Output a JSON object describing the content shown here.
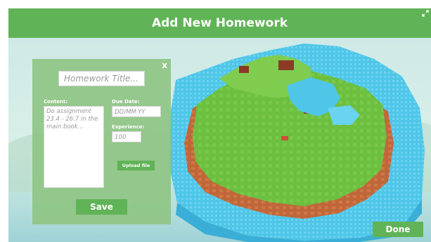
{
  "header": {
    "title": "Add New Homework"
  },
  "form": {
    "close_label": "x",
    "title_placeholder": "Homework Title...",
    "content_label": "Content:",
    "content_placeholder": "Do assignment 23.4 - 26.7 in the main book...",
    "due_date_label": "Due Date:",
    "due_date_placeholder": "DD/MM-YY",
    "experience_label": "Experience:",
    "experience_placeholder": "100",
    "upload_label": "Upload file",
    "save_label": "Save"
  },
  "footer": {
    "done_label": "Done"
  },
  "colors": {
    "accent": "#61b357",
    "panel": "#8fc484",
    "water": "#4fc6e8",
    "grass": "#6cbf3f",
    "dirt": "#c0673a"
  },
  "icons": {
    "expand": "expand-icon",
    "close": "close-icon"
  }
}
